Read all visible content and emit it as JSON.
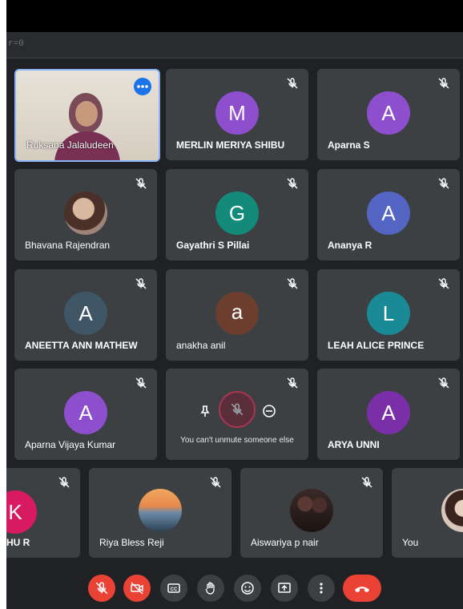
{
  "browser": {
    "url_fragment": "r=0"
  },
  "participants": {
    "p1": "Ruksana Jalaludeen",
    "p2": "MERLIN MERIYA SHIBU",
    "p3": "Aparna S",
    "p4": "Bhavana Rajendran",
    "p5": "Gayathri S Pillai",
    "p6": "Ananya R",
    "p7": "ANEETTA ANN MATHEW",
    "p8": "anakha anil",
    "p9": "LEAH ALICE PRINCE",
    "p10": "Aparna Vijaya Kumar",
    "p12": "ARYA UNNI",
    "p13": "HU R",
    "p14": "Riya Bless Reji",
    "p15": "Aiswariya p nair",
    "p16": "You"
  },
  "avatars": {
    "p2": "M",
    "p3": "A",
    "p5": "G",
    "p6": "A",
    "p7": "A",
    "p8": "a",
    "p9": "L",
    "p10": "A",
    "p12": "A",
    "p13": "K"
  },
  "hover_tile": {
    "message": "You can't unmute someone else"
  },
  "colors": {
    "background": "#202124",
    "tile": "#3c4043",
    "active_speaker_border": "#8ab4f8",
    "end_call": "#ea4335",
    "purple": "#8e4fcf",
    "indigo": "#5465c4",
    "teal": "#138a7a",
    "slate": "#3f5666",
    "brown": "#6b3e2e",
    "cyan": "#1a8a96",
    "violet": "#7a2fa8",
    "pink": "#d81b60"
  },
  "icons": {
    "mic_off": "mic-off-icon",
    "cam_off": "camera-off-icon",
    "captions": "captions-icon",
    "raise_hand": "raise-hand-icon",
    "emoji": "emoji-icon",
    "present": "present-screen-icon",
    "more": "more-vert-icon",
    "end_call": "end-call-icon",
    "pin": "pin-icon",
    "remove": "remove-icon"
  }
}
